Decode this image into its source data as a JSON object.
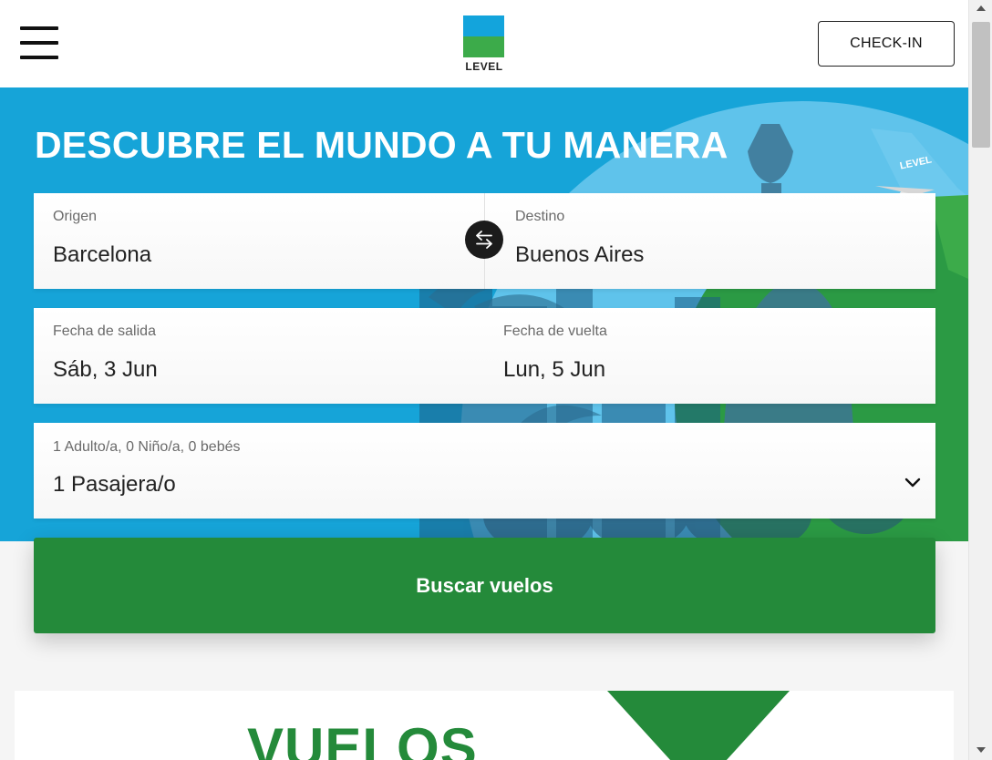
{
  "header": {
    "logo_text": "LEVEL",
    "checkin_label": "CHECK-IN"
  },
  "hero": {
    "title": "DESCUBRE EL MUNDO A TU MANERA",
    "plane_tail_text": "LEVEL"
  },
  "form": {
    "origin": {
      "label": "Origen",
      "value": "Barcelona"
    },
    "destination": {
      "label": "Destino",
      "value": "Buenos Aires"
    },
    "departure": {
      "label": "Fecha de salida",
      "value": "Sáb, 3 Jun"
    },
    "return": {
      "label": "Fecha de vuelta",
      "value": "Lun, 5 Jun"
    },
    "passengers": {
      "label": "1 Adulto/a, 0 Niño/a, 0 bebés",
      "value": "1 Pasajera/o"
    },
    "search_label": "Buscar vuelos"
  },
  "promo": {
    "title": "VUELOS"
  },
  "colors": {
    "hero_blue": "#16a4d8",
    "brand_green": "#248a3a",
    "logo_blue": "#13a4dc",
    "logo_green": "#3cab4a"
  },
  "icons": {
    "menu": "hamburger-icon",
    "swap": "swap-arrows-icon",
    "dropdown": "chevron-down-icon"
  }
}
